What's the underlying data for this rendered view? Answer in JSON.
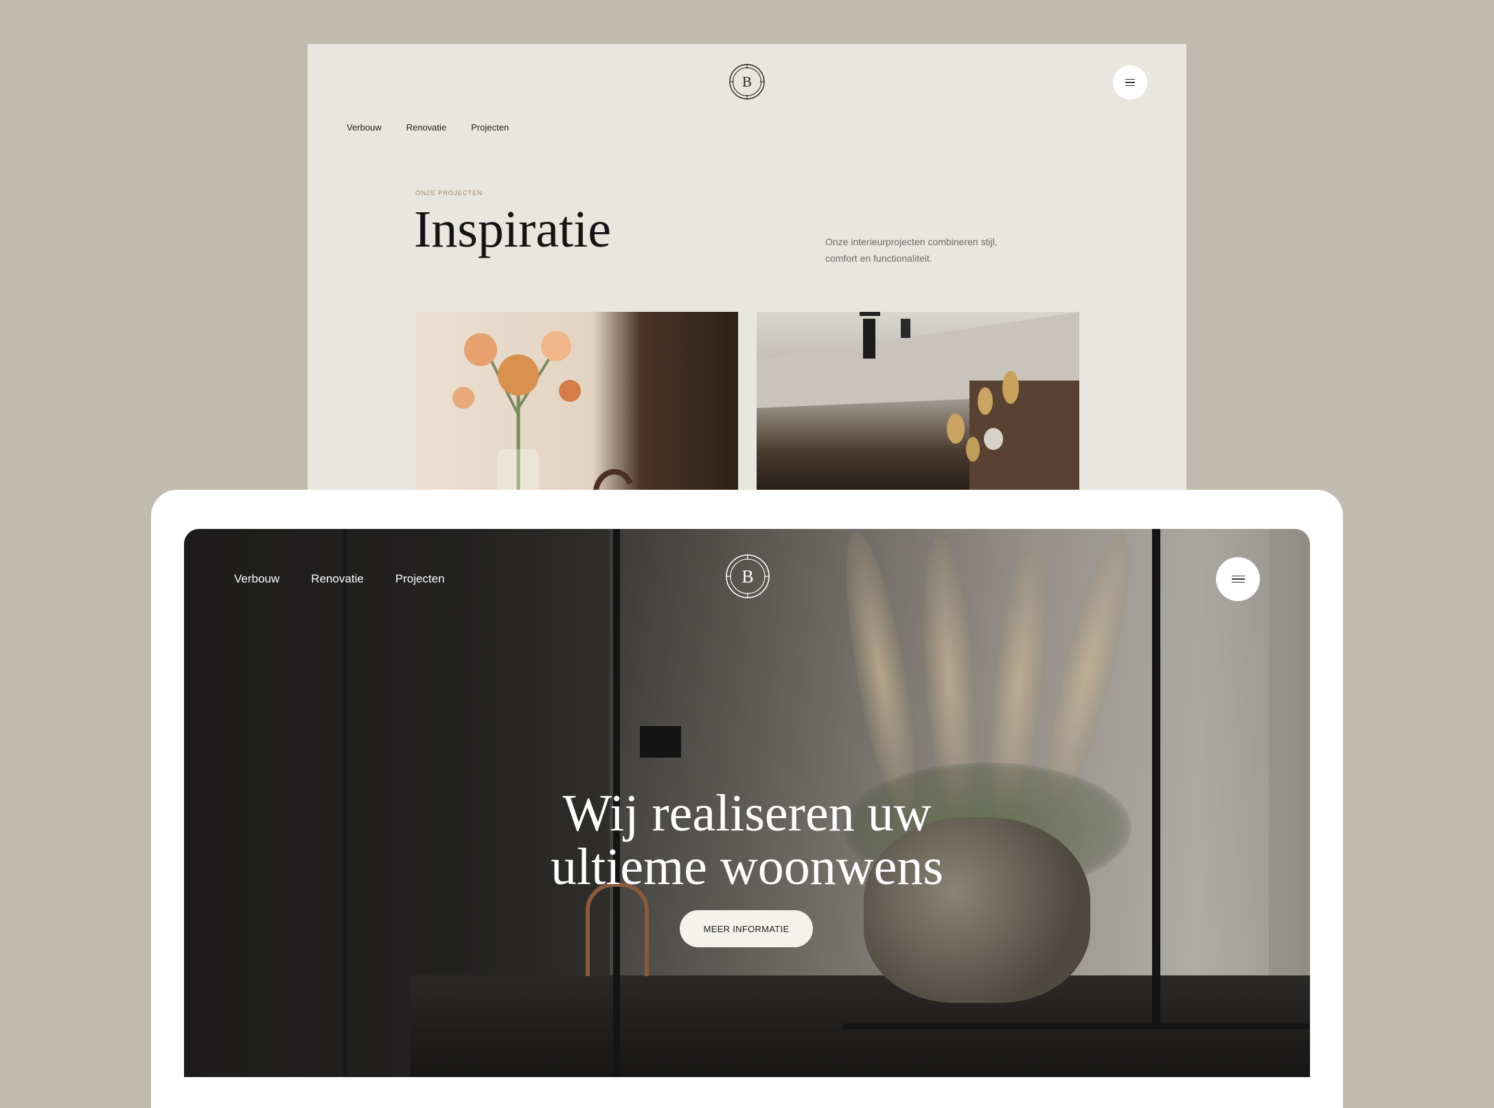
{
  "back_page": {
    "nav": [
      "Verbouw",
      "Renovatie",
      "Projecten"
    ],
    "logo_letter": "B",
    "eyebrow": "ONZE PROJECTEN",
    "title": "Inspiratie",
    "description": "Onze interieurprojecten combineren stijl, comfort en functionaliteit.",
    "menu_icon": "hamburger-icon"
  },
  "hero": {
    "nav": [
      "Verbouw",
      "Renovatie",
      "Projecten"
    ],
    "logo_letter": "B",
    "title_line1": "Wij realiseren uw",
    "title_line2": "ultieme woonwens",
    "cta_label": "MEER INFORMATIE",
    "menu_icon": "hamburger-icon"
  },
  "colors": {
    "background": "#c0bbaf",
    "page_background": "#e8e6df",
    "accent": "#a38a63"
  }
}
